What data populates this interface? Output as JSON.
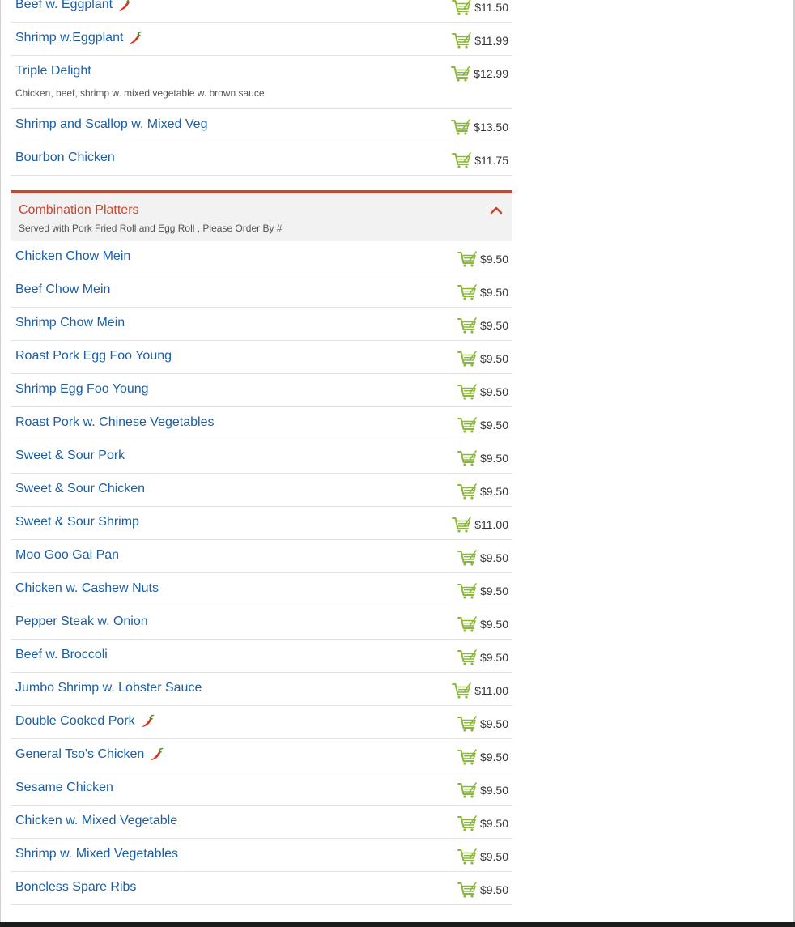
{
  "top_items": [
    {
      "name": "Beef w. Eggplant",
      "spicy": true,
      "price": "$11.50"
    },
    {
      "name": "Shrimp w.Eggplant",
      "spicy": true,
      "price": "$11.99"
    },
    {
      "name": "Triple Delight",
      "spicy": false,
      "price": "$12.99",
      "desc": "Chicken, beef, shrimp w. mixed vegetable w. brown sauce"
    },
    {
      "name": "Shrimp and Scallop w. Mixed Veg",
      "spicy": false,
      "price": "$13.50"
    },
    {
      "name": "Bourbon Chicken",
      "spicy": false,
      "price": "$11.75"
    }
  ],
  "section": {
    "title": "Combination Platters",
    "subtitle": "Served with Pork Fried Roll and Egg Roll , Please Order By #"
  },
  "combo_items": [
    {
      "name": "Chicken Chow Mein",
      "spicy": false,
      "price": "$9.50"
    },
    {
      "name": "Beef Chow Mein",
      "spicy": false,
      "price": "$9.50"
    },
    {
      "name": "Shrimp Chow Mein",
      "spicy": false,
      "price": "$9.50"
    },
    {
      "name": "Roast Pork Egg Foo Young",
      "spicy": false,
      "price": "$9.50"
    },
    {
      "name": "Shrimp Egg Foo Young",
      "spicy": false,
      "price": "$9.50"
    },
    {
      "name": "Roast Pork w. Chinese Vegetables",
      "spicy": false,
      "price": "$9.50"
    },
    {
      "name": "Sweet & Sour Pork",
      "spicy": false,
      "price": "$9.50"
    },
    {
      "name": "Sweet & Sour Chicken",
      "spicy": false,
      "price": "$9.50"
    },
    {
      "name": "Sweet & Sour Shrimp",
      "spicy": false,
      "price": "$11.00"
    },
    {
      "name": "Moo Goo Gai Pan",
      "spicy": false,
      "price": "$9.50"
    },
    {
      "name": "Chicken w. Cashew Nuts",
      "spicy": false,
      "price": "$9.50"
    },
    {
      "name": "Pepper Steak w. Onion",
      "spicy": false,
      "price": "$9.50"
    },
    {
      "name": "Beef w. Broccoli",
      "spicy": false,
      "price": "$9.50"
    },
    {
      "name": "Jumbo Shrimp w. Lobster Sauce",
      "spicy": false,
      "price": "$11.00"
    },
    {
      "name": "Double Cooked Pork",
      "spicy": true,
      "price": "$9.50"
    },
    {
      "name": "General Tso's Chicken",
      "spicy": true,
      "price": "$9.50"
    },
    {
      "name": "Sesame Chicken",
      "spicy": false,
      "price": "$9.50"
    },
    {
      "name": "Chicken w. Mixed Vegetable",
      "spicy": false,
      "price": "$9.50"
    },
    {
      "name": "Shrimp w. Mixed Vegetables",
      "spicy": false,
      "price": "$9.50"
    },
    {
      "name": "Boneless Spare Ribs",
      "spicy": false,
      "price": "$9.50"
    }
  ],
  "colors": {
    "link": "#1a5fa6",
    "accent": "#c9452d",
    "cart": "#8ab83a",
    "pepper": "#d9301f"
  },
  "icons": {
    "cart": "add-to-cart-icon",
    "spicy": "chili-pepper-icon",
    "collapse": "chevron-up-icon"
  }
}
